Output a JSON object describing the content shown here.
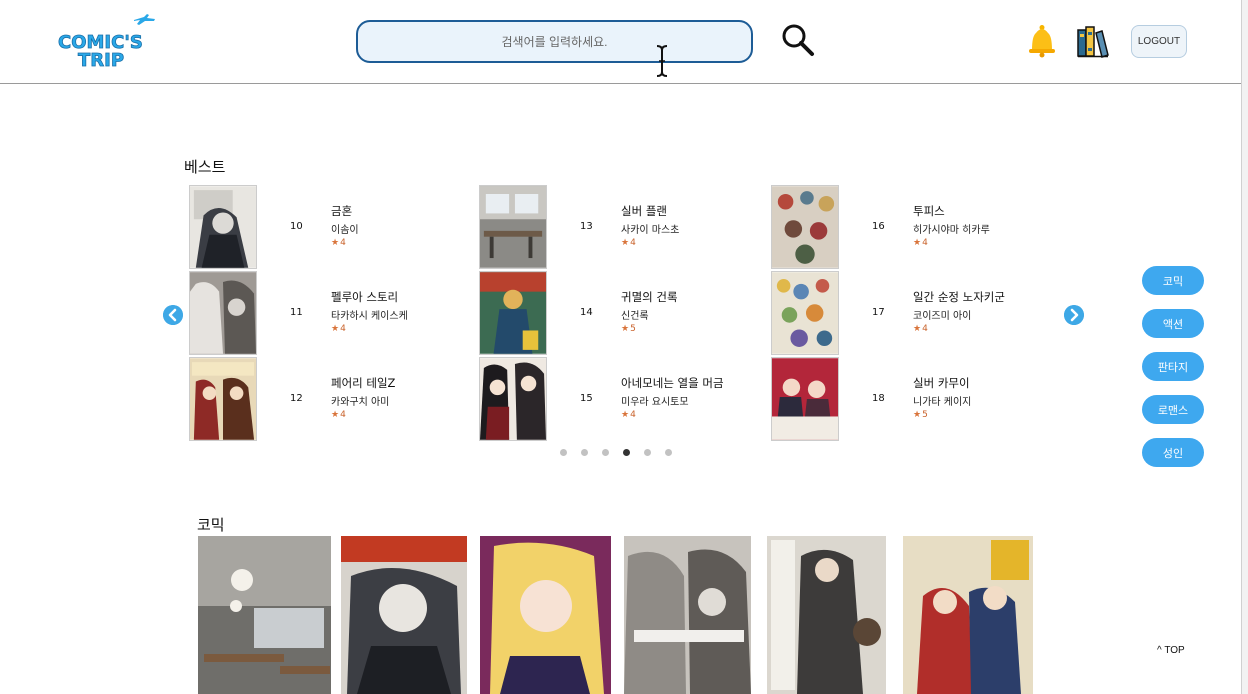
{
  "header": {
    "logo_text": "COMIC'S TRIP",
    "search_placeholder": "검색어를 입력하세요.",
    "logout_label": "LOGOUT",
    "icons": [
      "search-icon",
      "bell-icon",
      "bookshelf-icon"
    ]
  },
  "best": {
    "title": "베스트",
    "items": [
      {
        "rank": "10",
        "title": "금혼",
        "author": "이솜이",
        "rating": "4",
        "cover": "tokyo-ghoul"
      },
      {
        "rank": "11",
        "title": "펠루아 스토리",
        "author": "타카하시 케이스케",
        "rating": "4",
        "cover": "vampire-knight"
      },
      {
        "rank": "12",
        "title": "페어리 테일Z",
        "author": "카와구치 아미",
        "rating": "4",
        "cover": "shinbi"
      },
      {
        "rank": "13",
        "title": "실버 플랜",
        "author": "사카이 마스초",
        "rating": "4",
        "cover": "office-photo"
      },
      {
        "rank": "14",
        "title": "귀멸의 건록",
        "author": "신건록",
        "rating": "5",
        "cover": "green-boy"
      },
      {
        "rank": "15",
        "title": "아네모네는 열을 머금",
        "author": "미우라 요시토모",
        "rating": "4",
        "cover": "kaguya"
      },
      {
        "rank": "16",
        "title": "투피스",
        "author": "히가시야마 히카루",
        "rating": "4",
        "cover": "crowd"
      },
      {
        "rank": "17",
        "title": "일간 순정 노자키군",
        "author": "코이즈미 아이",
        "rating": "4",
        "cover": "nozaki"
      },
      {
        "rank": "18",
        "title": "실버 카무이",
        "author": "니가타 케이지",
        "rating": "5",
        "cover": "hana"
      }
    ],
    "page_count": 6,
    "active_page": 4
  },
  "genres": [
    "코믹",
    "액션",
    "판타지",
    "로맨스",
    "성인"
  ],
  "top_label": "TOP",
  "comic": {
    "title": "코믹",
    "covers": [
      "office-photo",
      "tokyo-ghoul-re",
      "blonde-girl",
      "vampire-knight-memories",
      "nozaki-5",
      "inuyasha"
    ]
  },
  "colors": {
    "accent": "#3ea8ef",
    "search_border": "#1d5c96",
    "rating": "#d9743b",
    "logo": "#2aa8e8"
  }
}
